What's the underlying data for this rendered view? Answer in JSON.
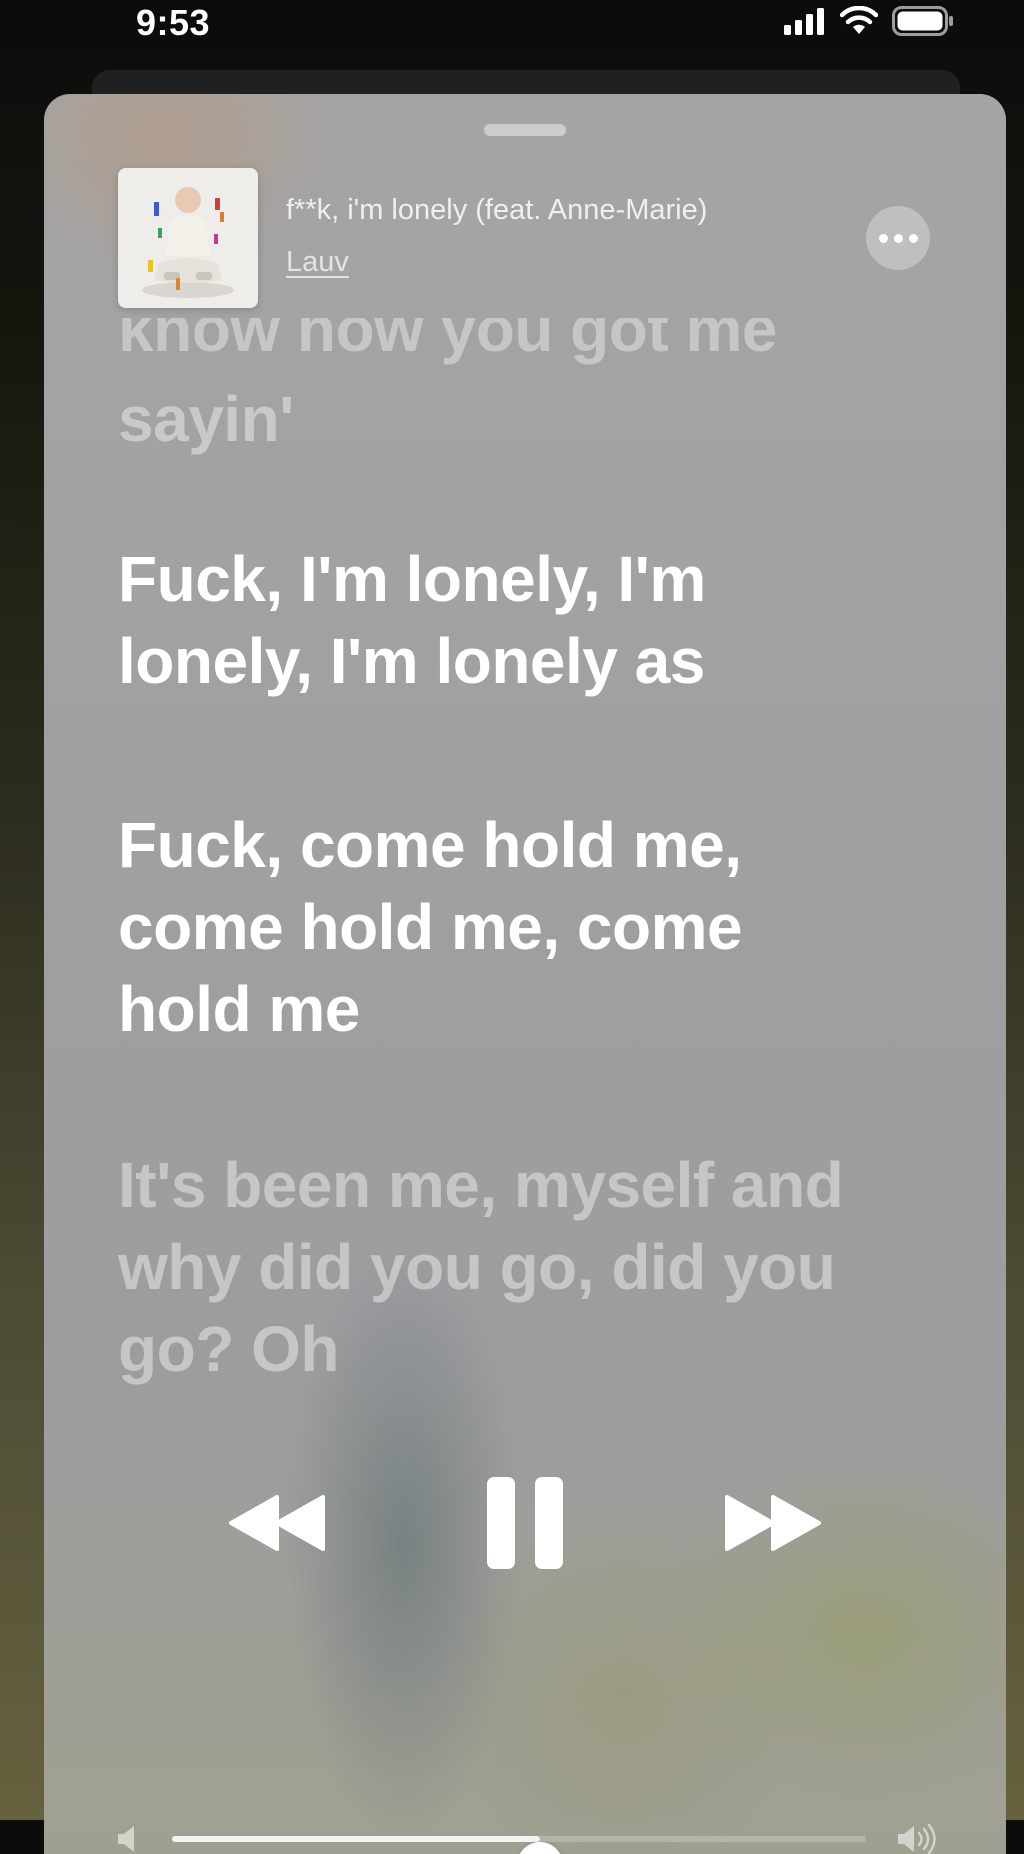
{
  "status_bar": {
    "time": "9:53",
    "icons": [
      "cellular-signal-icon",
      "wifi-icon",
      "battery-icon"
    ]
  },
  "now_playing": {
    "song_title": "f**k, i'm lonely (feat. Anne-Marie)",
    "artist": "Lauv",
    "more_icon": "ellipsis-icon"
  },
  "lyrics": {
    "previous_partial": "know how you got me",
    "previous": "sayin'",
    "active": [
      "Fuck, I'm lonely, I'm lonely, I'm lonely as",
      "Fuck, come hold me, come hold me, come hold me"
    ],
    "upcoming": "It's been me, myself and why did you go, did you go? Oh"
  },
  "controls": {
    "previous_icon": "rewind-icon",
    "pause_icon": "pause-icon",
    "next_icon": "fast-forward-icon",
    "state": "playing"
  },
  "volume": {
    "level": 0.53,
    "min_icon": "speaker-low-icon",
    "max_icon": "speaker-high-icon"
  },
  "colors": {
    "lyric_active": "#ffffff",
    "sheet_base": "#a0a1a3"
  }
}
